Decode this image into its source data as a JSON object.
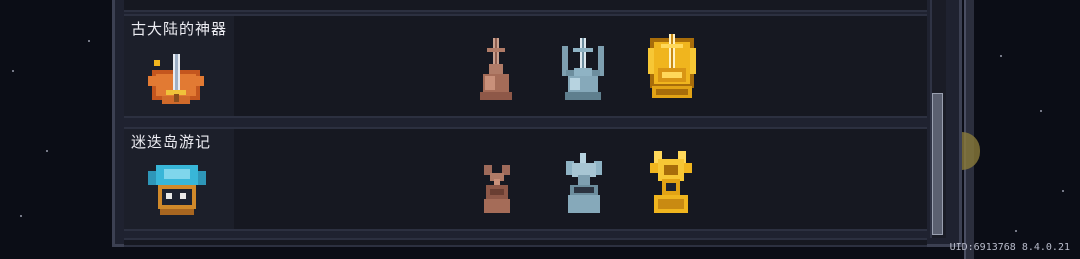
{
  "achievements": [
    {
      "title": "古大陆的神器",
      "icon": "ancient-artifact-sword-icon",
      "trophies": [
        "bronze-sword-trophy-icon",
        "silver-sword-trophy-icon",
        "gold-sword-trophy-icon"
      ]
    },
    {
      "title": "迷迭岛游记",
      "icon": "rosemary-island-plant-icon",
      "trophies": [
        "bronze-plant-trophy-icon",
        "silver-plant-trophy-icon",
        "gold-plant-trophy-icon"
      ]
    }
  ],
  "footer": {
    "uid": "UID:6913768 8.4.0.21"
  },
  "colors": {
    "bronze": "#b07b67",
    "silver": "#8fb3c4",
    "gold": "#f0b51e",
    "panel": "#161821"
  }
}
